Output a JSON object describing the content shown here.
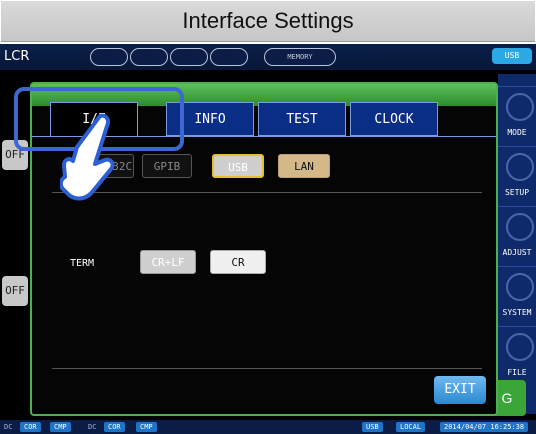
{
  "banner": {
    "title": "Interface Settings"
  },
  "topbar": {
    "app": "LCR",
    "memory": "MEMORY",
    "usb": "USB"
  },
  "tabs": [
    {
      "label": "I/F"
    },
    {
      "label": "INFO"
    },
    {
      "label": "TEST"
    },
    {
      "label": "CLOCK"
    }
  ],
  "interface_options": [
    "RS-232C",
    "GPIB",
    "USB",
    "LAN"
  ],
  "term": {
    "label": "TERM",
    "options": [
      "CR+LF",
      "CR"
    ]
  },
  "exit_label": "EXIT",
  "side": [
    "MODE",
    "SETUP",
    "ADJUST",
    "SYSTEM",
    "FILE"
  ],
  "left": [
    "OFF",
    "OFF"
  ],
  "bottombar": {
    "cor1": "COR",
    "cmp1": "CMP",
    "dc": "DC",
    "cor2": "COR",
    "cmp2": "CMP",
    "usb": "USB",
    "local": "LOCAL",
    "datetime": "2014/04/07 16:25:38"
  },
  "colors": {
    "accent": "#4caf50",
    "tab": "#0a2e86",
    "highlight": "#3f67d0"
  }
}
